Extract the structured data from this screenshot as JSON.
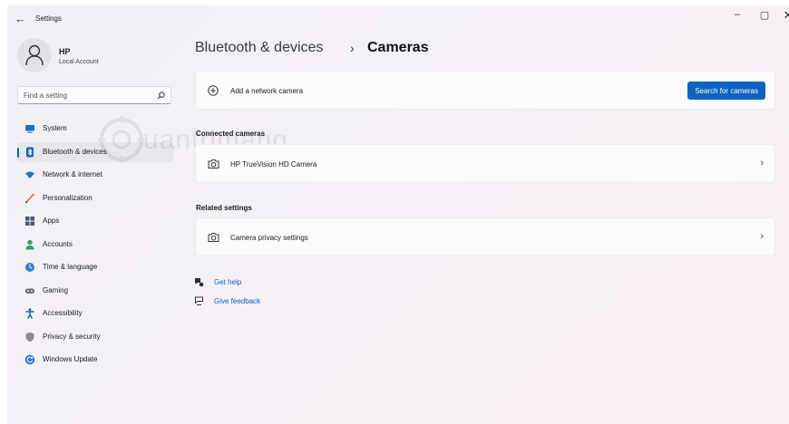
{
  "window": {
    "title": "Settings",
    "back_glyph": "←",
    "controls": {
      "minimize": "–",
      "maximize": "▢",
      "close": "✕"
    }
  },
  "profile": {
    "name": "HP",
    "account_type": "Local Account"
  },
  "search": {
    "placeholder": "Find a setting"
  },
  "nav": [
    {
      "label": "System",
      "icon": "monitor-icon",
      "color": "#1f6fc4",
      "active": false
    },
    {
      "label": "Bluetooth & devices",
      "icon": "bluetooth-icon",
      "color": "#1560bd",
      "active": true
    },
    {
      "label": "Network & internet",
      "icon": "wifi-icon",
      "color": "#2c6fc0",
      "active": false
    },
    {
      "label": "Personalization",
      "icon": "brush-icon",
      "color": "#d7733a",
      "active": false
    },
    {
      "label": "Apps",
      "icon": "apps-icon",
      "color": "#4a5a75",
      "active": false
    },
    {
      "label": "Accounts",
      "icon": "person-icon",
      "color": "#2c9f58",
      "active": false
    },
    {
      "label": "Time & language",
      "icon": "globe-clock-icon",
      "color": "#2f7fd0",
      "active": false
    },
    {
      "label": "Gaming",
      "icon": "gamepad-icon",
      "color": "#6b6b75",
      "active": false
    },
    {
      "label": "Accessibility",
      "icon": "accessibility-icon",
      "color": "#1a5fb5",
      "active": false
    },
    {
      "label": "Privacy & security",
      "icon": "shield-icon",
      "color": "#8a8a95",
      "active": false
    },
    {
      "label": "Windows Update",
      "icon": "update-icon",
      "color": "#1f73d0",
      "active": false
    }
  ],
  "breadcrumb": {
    "parent": "Bluetooth & devices",
    "separator": "›",
    "current": "Cameras"
  },
  "add_camera": {
    "label": "Add a network camera",
    "button": "Search for cameras"
  },
  "connected": {
    "heading": "Connected cameras",
    "items": [
      {
        "label": "HP TrueVision HD Camera"
      }
    ]
  },
  "related": {
    "heading": "Related settings",
    "items": [
      {
        "label": "Camera privacy settings"
      }
    ]
  },
  "help": {
    "get_help": "Get help",
    "give_feedback": "Give feedback"
  },
  "watermark": {
    "text": "uantrimang"
  },
  "colors": {
    "accent": "#1062c0",
    "link": "#0a5fb8"
  }
}
